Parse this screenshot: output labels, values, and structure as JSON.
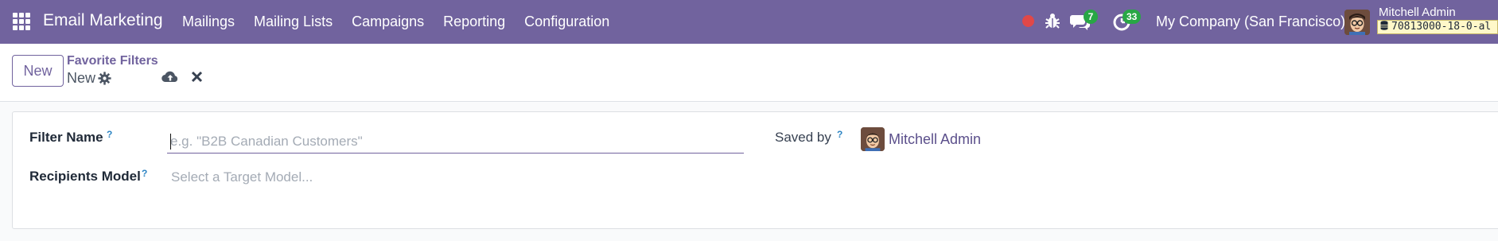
{
  "navbar": {
    "app_title": "Email Marketing",
    "menu": [
      "Mailings",
      "Mailing Lists",
      "Campaigns",
      "Reporting",
      "Configuration"
    ],
    "chat_count": "7",
    "activity_count": "33",
    "company": "My Company (San Francisco)",
    "user_name": "Mitchell Admin",
    "database": "70813000-18-0-al",
    "accent_color": "#71639e",
    "recording_color": "#e04848",
    "badge_color": "#28a745"
  },
  "control_panel": {
    "new_label": "New",
    "breadcrumb_parent": "Favorite Filters",
    "record_name": "New"
  },
  "form": {
    "filter_name_label": "Filter Name",
    "filter_name_placeholder": "e.g. \"B2B Canadian Customers\"",
    "filter_name_value": "",
    "recipients_model_label": "Recipients Model",
    "recipients_model_placeholder": "Select a Target Model...",
    "saved_by_label": "Saved by",
    "saved_by_value": "Mitchell Admin",
    "help_mark": "?"
  },
  "icons": {
    "apps": "apps-grid-icon",
    "recording": "recording-dot-icon",
    "debug": "bug-icon",
    "chat": "chat-icon",
    "activity": "clock-icon",
    "database": "database-icon",
    "settings": "gear-icon",
    "save": "cloud-upload-icon",
    "discard": "close-icon"
  }
}
